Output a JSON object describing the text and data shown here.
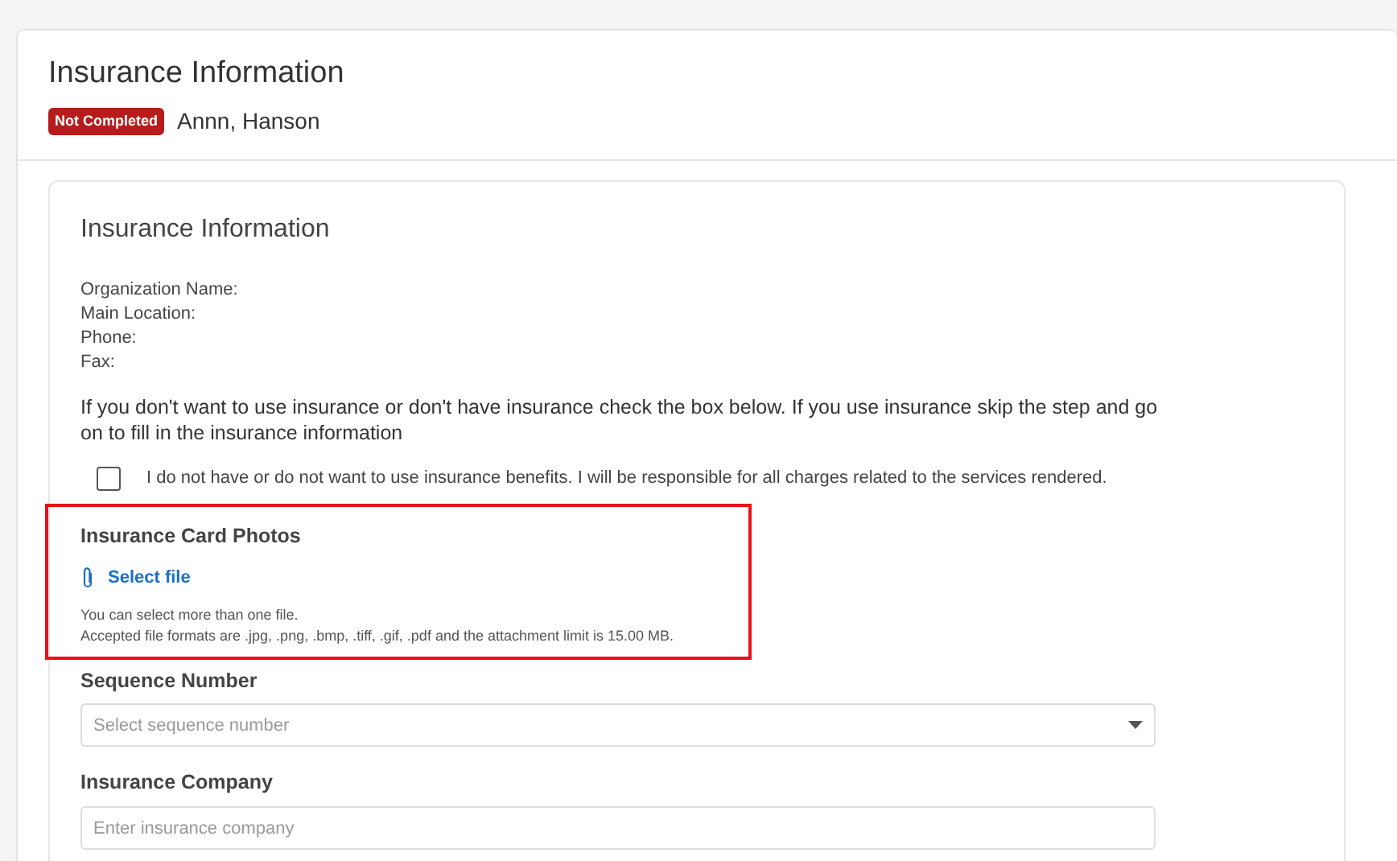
{
  "page": {
    "title": "Insurance Information",
    "status_badge": "Not Completed",
    "patient_name": "Annn, Hanson"
  },
  "section": {
    "title": "Insurance Information",
    "info_lines": [
      "Organization Name:",
      "Main Location:",
      "Phone:",
      "Fax:"
    ],
    "instruction": "If you don't want to use insurance or don't have insurance check the box below. If you use insurance skip the step and go on to fill in the insurance information",
    "no_insurance": {
      "label": "I do not have or do not want to use insurance benefits. I will be responsible for all charges related to the services rendered.",
      "checked": false
    },
    "card_photos": {
      "label": "Insurance Card Photos",
      "highlighted": true,
      "select_link": "Select file",
      "hints": [
        "You can select more than one file.",
        "Accepted file formats are .jpg, .png, .bmp, .tiff, .gif, .pdf and the attachment limit is 15.00 MB."
      ]
    },
    "fields": [
      {
        "kind": "select",
        "label": "Sequence Number",
        "placeholder": "Select sequence number"
      },
      {
        "kind": "text",
        "label": "Insurance Company",
        "placeholder": "Enter insurance company"
      }
    ]
  }
}
